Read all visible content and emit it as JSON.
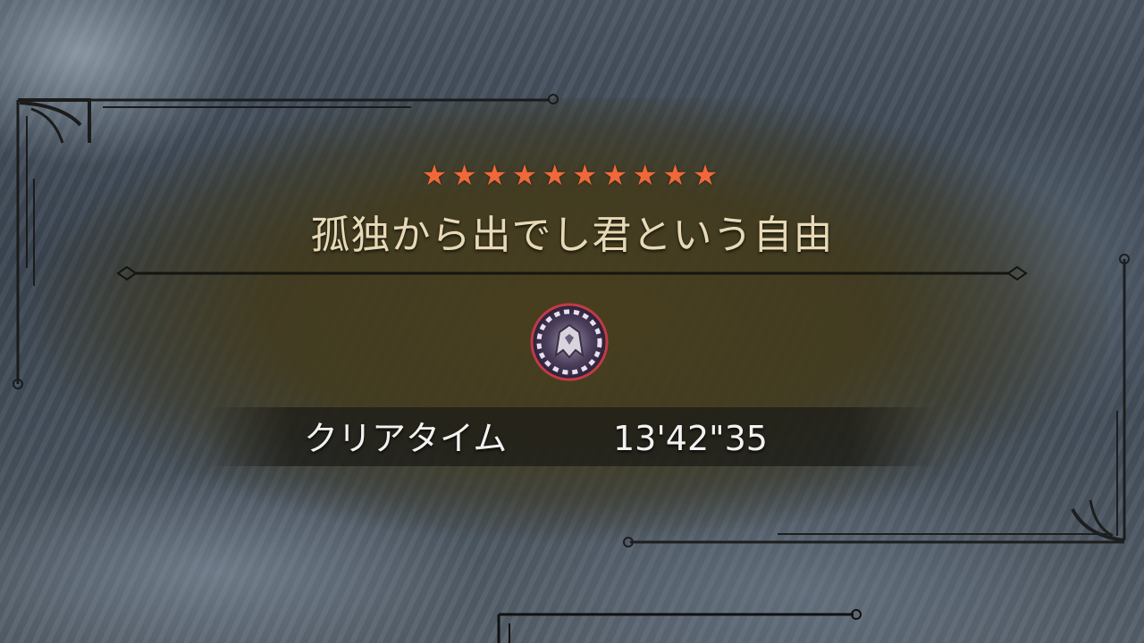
{
  "quest": {
    "rating_stars": 10,
    "star_color": "#f0683a",
    "title": "孤独から出でし君という自由"
  },
  "monster_icon": "monster-emblem-icon",
  "result": {
    "clear_time_label": "クリアタイム",
    "clear_time_value": "13'42\"35"
  }
}
